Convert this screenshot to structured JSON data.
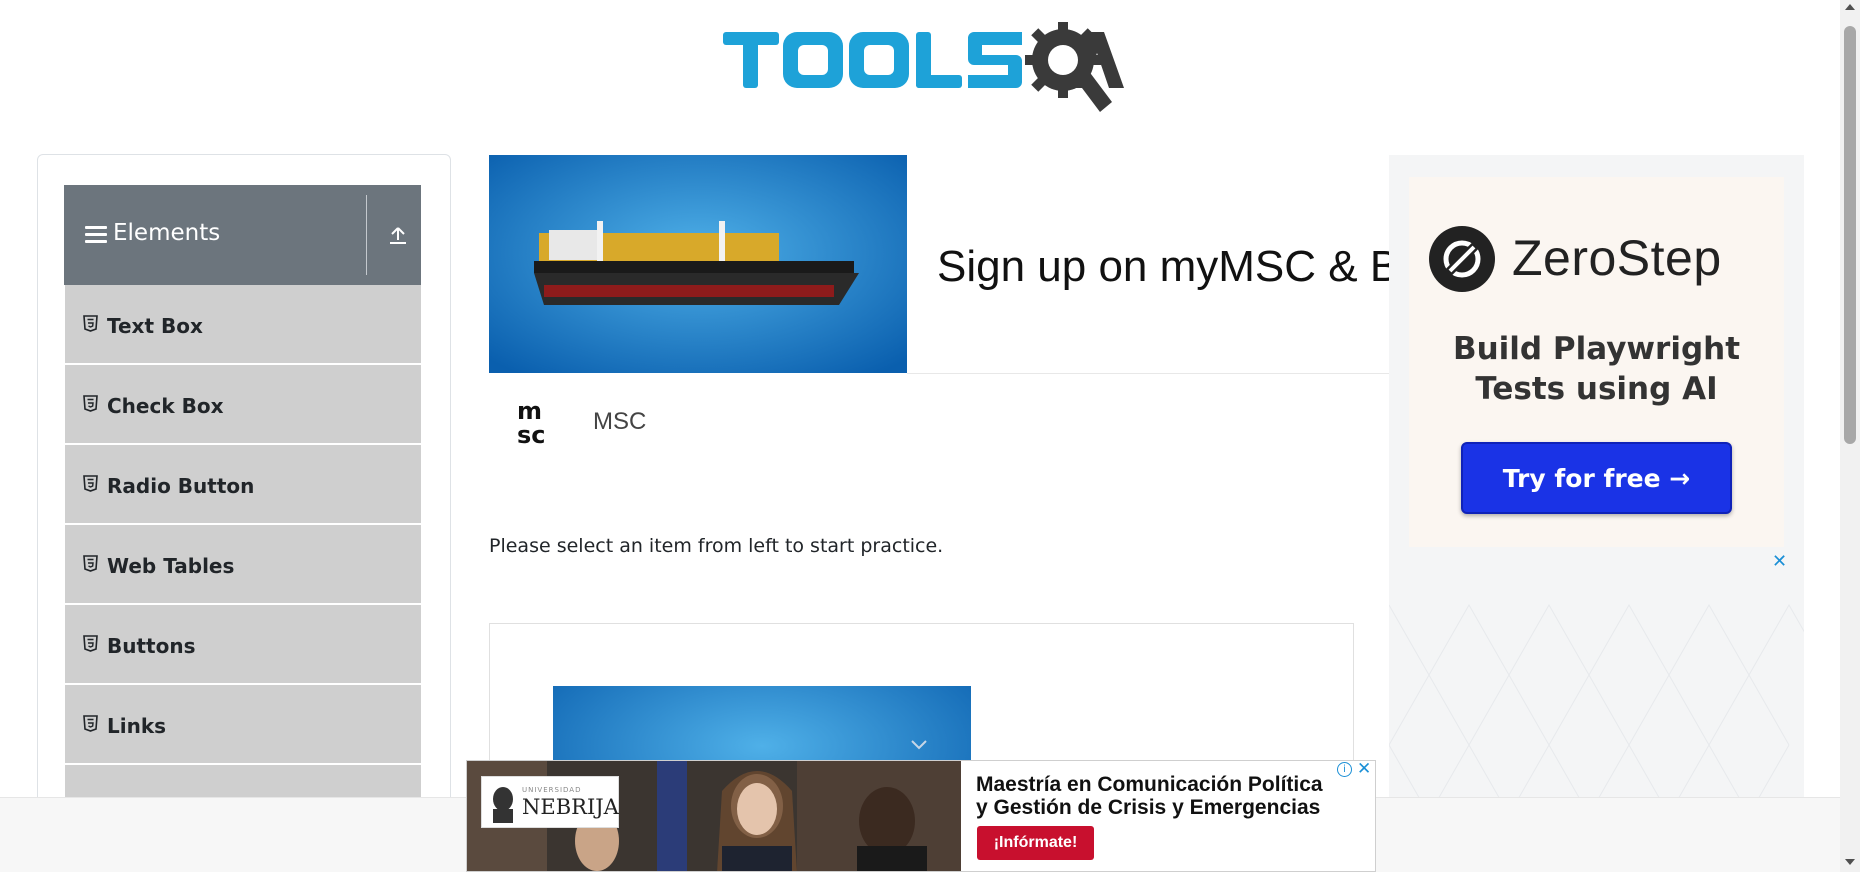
{
  "header": {
    "logo_alt": "TOOLSQA"
  },
  "sidebar": {
    "group_title": "Elements",
    "items": [
      {
        "label": "Text Box",
        "icon": "html5-icon"
      },
      {
        "label": "Check Box",
        "icon": "html5-icon"
      },
      {
        "label": "Radio Button",
        "icon": "html5-icon"
      },
      {
        "label": "Web Tables",
        "icon": "html5-icon"
      },
      {
        "label": "Buttons",
        "icon": "html5-icon"
      },
      {
        "label": "Links",
        "icon": "html5-icon"
      }
    ]
  },
  "main": {
    "ad": {
      "headline": "Sign up on myMSC & B",
      "brand_name": "MSC"
    },
    "practice_text": "Please select an item from left to start practice."
  },
  "right_ad": {
    "brand": "ZeroStep",
    "tagline": "Build Playwright Tests using AI",
    "tagline_line1": "Build Playwright",
    "tagline_line2": "Tests using AI",
    "cta": "Try for free →",
    "close": "✕"
  },
  "banner_ad": {
    "university_small": "UNIVERSIDAD",
    "university_name": "NEBRIJA",
    "line1": "Maestría en Comunicación Política",
    "line2": "y Gestión de Crisis y Emergencias",
    "cta": "¡Infórmate!",
    "info": "i",
    "close": "✕"
  },
  "colors": {
    "logo_blue": "#1ea2d8",
    "logo_gray": "#3a3a3a",
    "sidebar_header": "#6c757d",
    "menu_item_bg": "#cfcfcf",
    "zerostep_cta": "#1a33e6",
    "banner_cta": "#c8102e"
  }
}
